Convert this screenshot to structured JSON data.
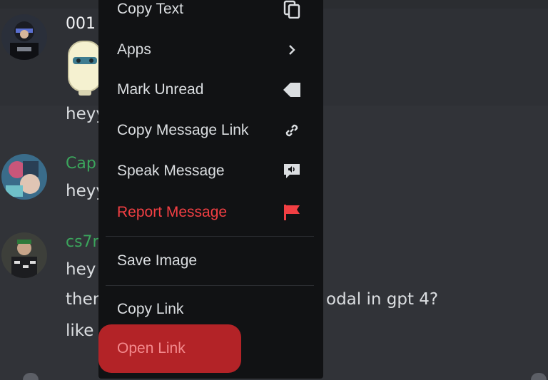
{
  "colors": {
    "background": "#313338",
    "menu_background": "#111214",
    "danger": "#f23f43",
    "open_link_highlight": "#b32327",
    "username_green": "#3ba55c"
  },
  "messages": [
    {
      "username": "001",
      "text": "heyy",
      "has_sticker": true
    },
    {
      "username": "Cap",
      "text": "heyy"
    },
    {
      "username": "cs7r",
      "lines": [
        "hey",
        "ther",
        "odal in gpt 4?",
        "like"
      ]
    }
  ],
  "context_menu": {
    "items": [
      {
        "label": "Copy Text",
        "icon": "copy-icon"
      },
      {
        "label": "Apps",
        "icon": "chevron-right-icon"
      },
      {
        "label": "Mark Unread",
        "icon": "mark-unread-icon"
      },
      {
        "label": "Copy Message Link",
        "icon": "link-icon"
      },
      {
        "label": "Speak Message",
        "icon": "speak-icon"
      },
      {
        "label": "Report Message",
        "icon": "flag-icon",
        "danger": true
      },
      {
        "label": "Save Image"
      },
      {
        "label": "Copy Link"
      },
      {
        "label": "Open Link",
        "highlighted": true
      }
    ]
  }
}
